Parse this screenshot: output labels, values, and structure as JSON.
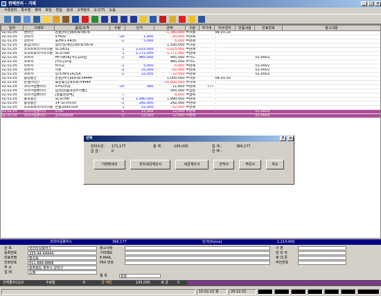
{
  "window": {
    "title": "판매관리 - 거래"
  },
  "menu": [
    "서류관리",
    "특수점",
    "출력",
    "파일",
    "편집",
    "검색",
    "고객관리",
    "도구(T)",
    "도움"
  ],
  "grid": {
    "columns": [
      "일자",
      "거래처",
      "품목/규격",
      "수량",
      "단가",
      "금액",
      "구분",
      "부가세",
      "미수일자",
      "반품내용",
      "전표번호",
      "참고내용"
    ],
    "rows": [
      [
        "02.01.05",
        "엔터인",
        "온윈[하나]네트워크B76",
        "",
        "",
        "-1,380,000",
        "=이월",
        "",
        "04.03.10",
        "",
        "",
        ""
      ],
      [
        "02.01.05",
        "소비자",
        "S'HDD",
        "-20",
        "1,000",
        "-20,000",
        "=판매",
        "",
        ".",
        "",
        "",
        ""
      ],
      [
        "02.01.05",
        "소비자",
        "포/HP1-6435",
        "-1",
        "5,000",
        "-5,000",
        "=판매",
        "",
        ".",
        "",
        "",
        ""
      ],
      [
        "02.01.05",
        "윤업(국민)",
        "빌리언[재산]네트워크B76",
        "",
        "",
        "1,500,000",
        "=이월",
        "",
        ".",
        "",
        "",
        ""
      ],
      [
        "02.01.05",
        "소프트트리지시스템",
        "SCSI632",
        "1",
        "1,023,000",
        "-1,023,000",
        "=판매",
        "",
        ".",
        "",
        "",
        ""
      ],
      [
        "02.01.05",
        "소프트트리지시스템",
        "SCSI766",
        "1",
        "1,771,000",
        "-1,771,000",
        "=판매",
        "",
        ".",
        "",
        "",
        ""
      ],
      [
        "02.01.05",
        "소비자",
        "HP-5B5K[카드]10일",
        "-1",
        "485,000",
        "485,000",
        "=카드",
        "",
        ".",
        "",
        "01-0002",
        ""
      ],
      [
        "02.01.05",
        "소비자",
        "[카드]10일",
        "",
        "",
        "485,000",
        "=카드",
        "",
        ".",
        "",
        "",
        ""
      ],
      [
        "02.01.05",
        "소비자",
        "비지오",
        "-1",
        "5,000",
        "-5,000",
        "=판매",
        "",
        ".",
        "",
        "01-0002",
        ""
      ],
      [
        "02.01.05",
        "소비자",
        "지원",
        "-2",
        "25,000",
        "-50,000",
        "=판매",
        "",
        ".",
        "",
        "01-0002",
        ""
      ],
      [
        "02.01.05",
        "소비자",
        "잉크/HP51625A",
        "-1",
        "22,000",
        "-22,000",
        "=판매",
        "",
        ".",
        "",
        "01-0002",
        ""
      ],
      [
        "02.01.05",
        "총성통신",
        "온윈[하나]네트워크4444",
        "",
        "",
        "1,000,000",
        "=이월",
        "",
        "04.03.30",
        "",
        "",
        ""
      ],
      [
        "02.01.05",
        "은행(국민)",
        "표준통신[네트워크4444",
        "",
        "",
        "-10,000,000",
        "=이체",
        "",
        ".",
        "",
        "",
        ""
      ],
      [
        "02.01.05",
        "코리아실플러스",
        "S'HD/FDJ",
        "-20",
        "580",
        "11,600",
        "=판매",
        "777",
        ".",
        "",
        "",
        ""
      ],
      [
        "02.01.05",
        "코리아실플러스",
        "캡처[상품대금부지불]",
        "",
        "",
        "500,000",
        "=입금",
        "",
        ".",
        "",
        "",
        ""
      ],
      [
        "02.01.05",
        "코리아실플러스",
        "[상품권금액]",
        "7",
        "",
        "-9,000",
        "=결제",
        "",
        ".",
        "",
        "",
        ""
      ],
      [
        "02.01.05",
        "총성통신",
        "SCSI766",
        "-1",
        "1,990,000",
        "1,990,000",
        "=판매",
        "",
        ".",
        "",
        "",
        ""
      ],
      [
        "02.01.05",
        "총성통신",
        "14\"모니터/3V",
        "-1",
        "242,000",
        "242,000",
        "=판매",
        "",
        ".",
        "",
        "",
        ""
      ],
      [
        "02.01.05",
        "소프트트리지시스템",
        "한글2000.0UP",
        "1",
        "52,000",
        "-52,000",
        "=판매",
        "",
        ".",
        "",
        "",
        ""
      ],
      [
        "02.01.05",
        "코리아실플러스",
        "S'HD",
        "-1",
        "12,000",
        "12,000",
        "=판매",
        "",
        ".",
        "",
        "01-0003",
        ""
      ],
      [
        "02.01.05",
        "코리아실플러스",
        "잉크/Stylus",
        "-1",
        "12,000",
        "12,000",
        "=판매",
        "",
        ".",
        "",
        "01-0003",
        ""
      ]
    ]
  },
  "dialog": {
    "title": "선택",
    "total_label": "전미수금 :",
    "total_value": "171,177",
    "sum_label": "총   계 :",
    "sum_value": "195,000",
    "sum2_label": "합   계 :",
    "sum2_value": "366,177",
    "in_label": "입   금 :",
    "in_value": "0",
    "balance_label": "잔   액 :",
    "buttons": [
      "거래명세서",
      "전자세금계산서",
      "세금계산서",
      "견적서",
      "주문서",
      "취소"
    ],
    "help_label": "?",
    "close_label": "×"
  },
  "summary": {
    "company": "코리아실플러스",
    "amount": "366,177",
    "item": "잉크[Stylus]",
    "total": "1,214,400"
  },
  "detail": {
    "labels": [
      "상    호",
      "등록번호",
      "대표자명",
      "전화번호",
      "주    소",
      "업    태"
    ],
    "values": [
      "코리아실플러스",
      "333-44-44444",
      "홍길동",
      "011-888-8888",
      "충청북도 청주시 상당구",
      "소매"
    ],
    "mid_labels": [
      "참고사항",
      "기타메모",
      "E-MAIL",
      "FAX 번호"
    ],
    "mid_values": [
      "",
      "",
      "",
      ""
    ],
    "right_labels": [
      "구    분",
      "담 당 자",
      "휴 대 폰",
      "주민번호"
    ],
    "kind_label": "종    목",
    "kind_value": "잡용"
  },
  "bottom": {
    "sel": "선택줄수[2]/2",
    "qty_label": "수량합",
    "qty": "-6",
    "amount_label": "금 액합",
    "amount": "195,000",
    "vat_label": "세 금",
    "vat": "0"
  },
  "status": {
    "date": "10.02.22 월",
    "time": "20:22:21"
  }
}
